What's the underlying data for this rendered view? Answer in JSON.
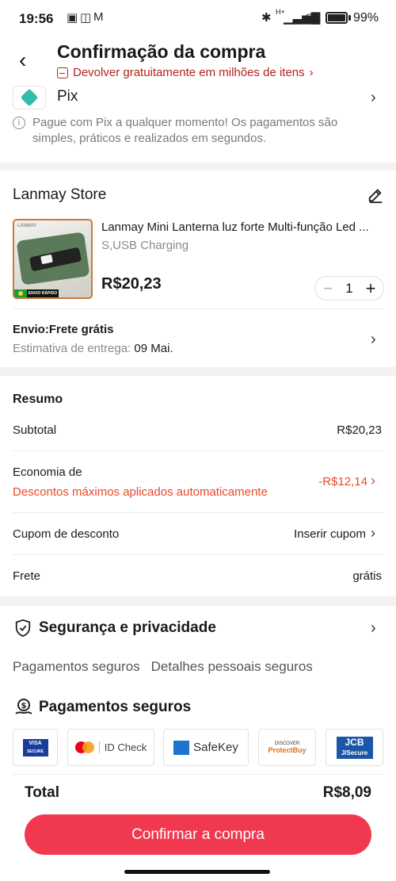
{
  "status_bar": {
    "time": "19:56",
    "battery": "99%",
    "network": "H+"
  },
  "header": {
    "back_icon": "back-arrow",
    "title": "Confirmação da compra",
    "return_notice": "Devolver gratuitamente em milhões de itens",
    "return_chevron": "›"
  },
  "payment": {
    "method": "Pix",
    "note": "Pague com Pix a qualquer momento! Os pagamentos são simples, práticos e realizados em segundos.",
    "chevron": "›",
    "info_glyph": "i"
  },
  "store": {
    "name": "Lanmay Store",
    "product": {
      "title": "Lanmay Mini Lanterna luz forte Multi-função Led ...",
      "variant": "S,USB Charging",
      "price": "R$20,23",
      "quantity": "1",
      "thumb_brand": "LANMAY",
      "thumb_tag": "ENVIO RÁPIDO"
    },
    "shipping": {
      "title": "Envio:Frete grátis",
      "estimate_label": "Estimativa de entrega:",
      "estimate_date": "09 Mai."
    }
  },
  "summary": {
    "title": "Resumo",
    "subtotal_label": "Subtotal",
    "subtotal_value": "R$20,23",
    "savings_label": "Economia de",
    "savings_note": "Descontos máximos aplicados automaticamente",
    "savings_value": "-R$12,14",
    "coupon_label": "Cupom de desconto",
    "coupon_value": "Inserir cupom",
    "shipping_label": "Frete",
    "shipping_value": "grátis"
  },
  "security": {
    "title": "Segurança e privacidade",
    "tags": [
      "Pagamentos seguros",
      "Detalhes pessoais seguros"
    ],
    "payments_title": "Pagamentos seguros",
    "badges": {
      "visa": "VISA",
      "visa_sub": "SECURE",
      "mastercard": "ID Check",
      "amex": "SafeKey",
      "discover": "DISCOVER",
      "discover_sub": "ProtectBuy",
      "jcb": "JCB",
      "jcb_sub": "J/Secure"
    }
  },
  "footer": {
    "total_label": "Total",
    "total_value": "R$8,09",
    "confirm_label": "Confirmar a compra"
  },
  "colors": {
    "accent": "#f0394f",
    "discount_red": "#e8472c",
    "return_red": "#b0241b",
    "pix_teal": "#32bcad"
  }
}
